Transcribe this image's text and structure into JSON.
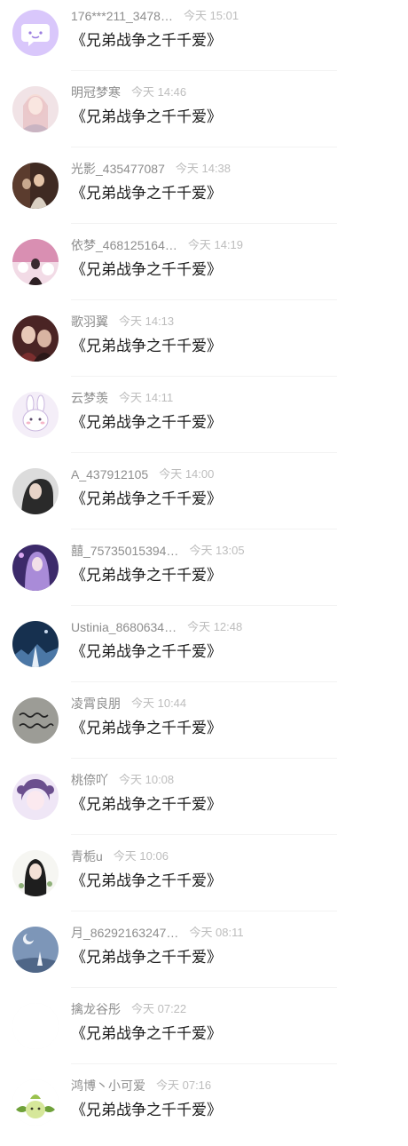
{
  "comments": [
    {
      "username": "176***211_3478…",
      "time": "今天 15:01",
      "text": "《兄弟战争之千千爱》",
      "avatar": "chat-bubble-icon",
      "accent": "#b89cf2"
    },
    {
      "username": "明冠梦寒",
      "time": "今天 14:46",
      "text": "《兄弟战争之千千爱》",
      "avatar": "user-photo",
      "accent": "#e9c8c8"
    },
    {
      "username": "光影_435477087",
      "time": "今天 14:38",
      "text": "《兄弟战争之千千爱》",
      "avatar": "user-photo",
      "accent": "#6a4a3a"
    },
    {
      "username": "依梦_468125164…",
      "time": "今天 14:19",
      "text": "《兄弟战争之千千爱》",
      "avatar": "user-photo",
      "accent": "#c78fb0"
    },
    {
      "username": "歌羽翼",
      "time": "今天 14:13",
      "text": "《兄弟战争之千千爱》",
      "avatar": "user-photo",
      "accent": "#7a3a3a"
    },
    {
      "username": "云梦羡",
      "time": "今天 14:11",
      "text": "《兄弟战争之千千爱》",
      "avatar": "bunny-illustration",
      "accent": "#f3ecf7"
    },
    {
      "username": "A_437912105",
      "time": "今天 14:00",
      "text": "《兄弟战争之千千爱》",
      "avatar": "user-photo",
      "accent": "#3a3a3a"
    },
    {
      "username": "囍_75735015394…",
      "time": "今天 13:05",
      "text": "《兄弟战争之千千爱》",
      "avatar": "user-photo",
      "accent": "#5a3f8f"
    },
    {
      "username": "Ustinia_8680634…",
      "time": "今天 12:48",
      "text": "《兄弟战争之千千爱》",
      "avatar": "user-photo",
      "accent": "#1e3a5f"
    },
    {
      "username": "凌霄良朋",
      "time": "今天 10:44",
      "text": "《兄弟战争之千千爱》",
      "avatar": "handwriting-photo",
      "accent": "#9a9a94"
    },
    {
      "username": "桃倷吖",
      "time": "今天 10:08",
      "text": "《兄弟战争之千千爱》",
      "avatar": "user-photo",
      "accent": "#b49ad0"
    },
    {
      "username": "青栀u",
      "time": "今天 10:06",
      "text": "《兄弟战争之千千爱》",
      "avatar": "user-photo",
      "accent": "#2a2a2a"
    },
    {
      "username": "月_86292163247…",
      "time": "今天 08:11",
      "text": "《兄弟战争之千千爱》",
      "avatar": "user-photo",
      "accent": "#6e86a8"
    },
    {
      "username": "擒龙谷彤",
      "time": "今天 07:22",
      "text": "《兄弟战争之千千爱》",
      "avatar": "blank-avatar",
      "accent": "#ffffff"
    },
    {
      "username": "鸿博丶小可爱",
      "time": "今天 07:16",
      "text": "《兄弟战争之千千爱》",
      "avatar": "bunny-illustration",
      "accent": "#a8c96a"
    }
  ]
}
